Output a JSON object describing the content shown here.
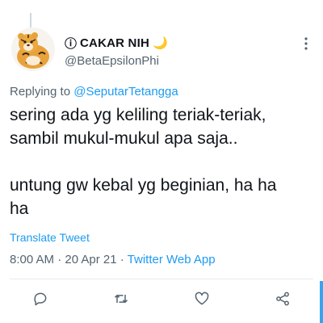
{
  "tweet": {
    "author": {
      "name_prefix": "ⓘ",
      "display_name": "CAKAR NIH",
      "name_emoji": "🌙",
      "handle": "@BetaEpsilonPhi",
      "avatar_icon": "tiger-avatar"
    },
    "replying_to_prefix": "Replying to ",
    "replying_to_handle": "@SeputarTetangga",
    "text": "sering ada yg keliling teriak-teriak,\nsambil mukul-mukul apa saja..\n\nuntung gw kebal yg beginian, ha ha\nha",
    "translate_label": "Translate Tweet",
    "time": "8:00 AM",
    "separator": " · ",
    "date": "20 Apr 21",
    "source": "Twitter Web App"
  },
  "actions": [
    {
      "name": "reply",
      "icon": "reply-icon"
    },
    {
      "name": "retweet",
      "icon": "retweet-icon"
    },
    {
      "name": "like",
      "icon": "heart-icon"
    },
    {
      "name": "share",
      "icon": "share-icon"
    }
  ],
  "colors": {
    "accent": "#1d9bf0",
    "text": "#0f1419",
    "secondary": "#536471",
    "divider": "#e6ecf0"
  }
}
